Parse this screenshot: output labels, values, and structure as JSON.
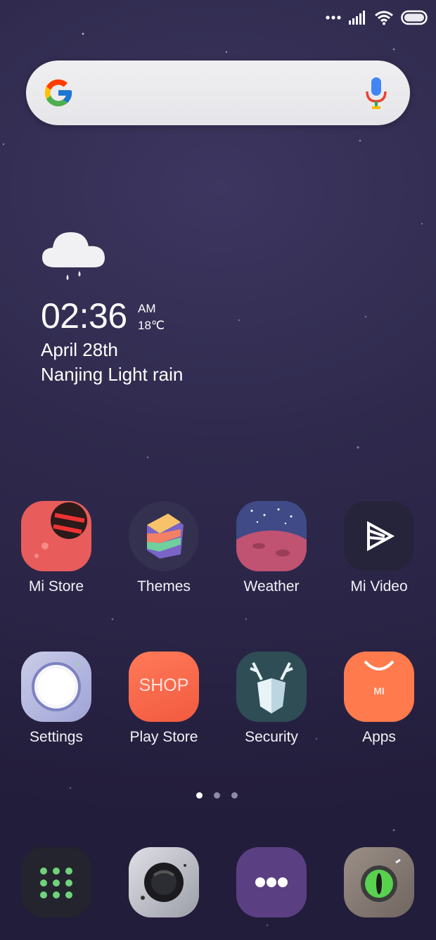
{
  "status_bar": {
    "icons": [
      "dots-icon",
      "signal-icon",
      "wifi-icon",
      "battery-icon"
    ]
  },
  "search_bar": {
    "logo": "google-logo-icon",
    "mic": "mic-icon"
  },
  "widget": {
    "time": "02:36",
    "ampm": "AM",
    "temp": "18℃",
    "date": "April 28th",
    "location_weather": "Nanjing Light rain",
    "icon": "rain-cloud-icon"
  },
  "apps_row1": [
    {
      "label": "Mi Store"
    },
    {
      "label": "Themes"
    },
    {
      "label": "Weather"
    },
    {
      "label": "Mi Video"
    }
  ],
  "apps_row2": [
    {
      "label": "Settings"
    },
    {
      "label": "Play Store"
    },
    {
      "label": "Security"
    },
    {
      "label": "Apps"
    }
  ],
  "play_store_icon_text": "SHOP",
  "apps_icon_text": "MI",
  "page_indicator": {
    "count": 3,
    "active": 1
  },
  "dock": [
    {
      "name": "dialer-grid-icon"
    },
    {
      "name": "camera-icon"
    },
    {
      "name": "messages-icon"
    },
    {
      "name": "gallery-eye-icon"
    }
  ],
  "colors": {
    "wallpaper": "#2f2a4d",
    "search_bg": "#ececef",
    "dot_active": "#ffffff",
    "dot_inactive": "#8f8aa8"
  }
}
